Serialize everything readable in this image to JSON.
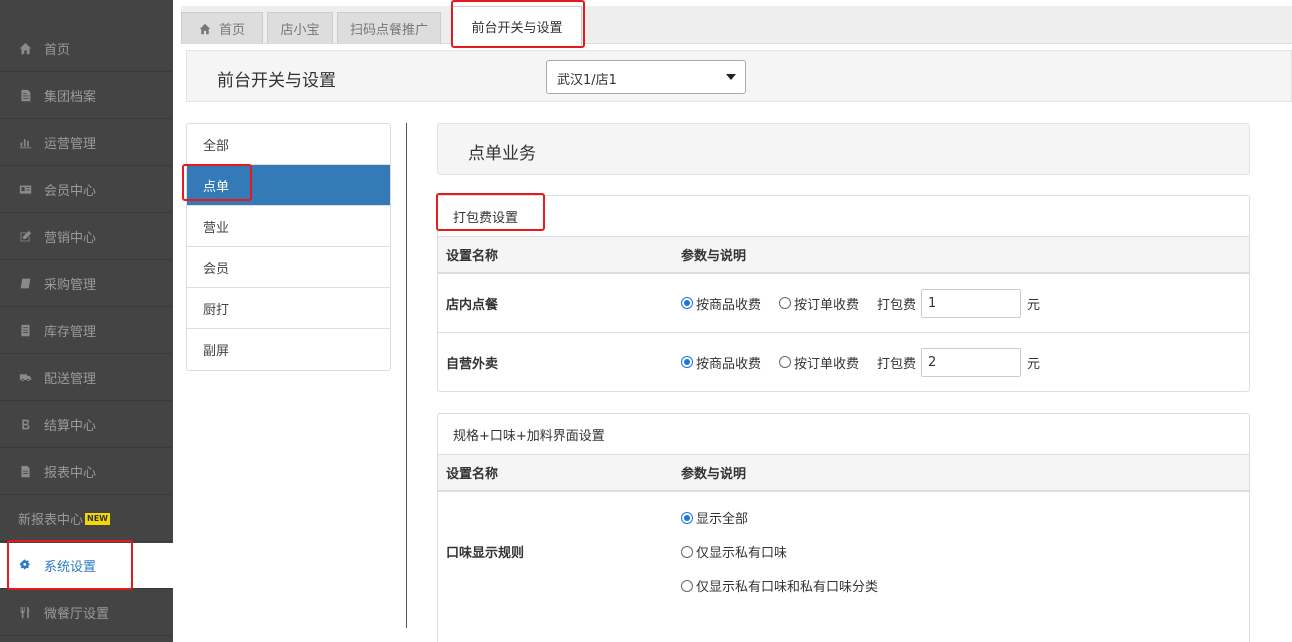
{
  "sidebar": {
    "items": [
      {
        "label": "首页",
        "icon": "home-icon"
      },
      {
        "label": "集团档案",
        "icon": "file-icon"
      },
      {
        "label": "运营管理",
        "icon": "bar-chart-icon"
      },
      {
        "label": "会员中心",
        "icon": "id-card-icon"
      },
      {
        "label": "营销中心",
        "icon": "edit-icon"
      },
      {
        "label": "采购管理",
        "icon": "book-icon"
      },
      {
        "label": "库存管理",
        "icon": "box-icon"
      },
      {
        "label": "配送管理",
        "icon": "truck-icon"
      },
      {
        "label": "结算中心",
        "icon": "bitcoin-icon"
      },
      {
        "label": "报表中心",
        "icon": "document-icon"
      },
      {
        "label": "新报表中心",
        "badge": "NEW"
      },
      {
        "label": "系统设置",
        "icon": "gears-icon"
      },
      {
        "label": "微餐厅设置",
        "icon": "cutlery-icon"
      }
    ]
  },
  "tabs": [
    {
      "label": "首页",
      "icon": "home-icon"
    },
    {
      "label": "店小宝"
    },
    {
      "label": "扫码点餐推广"
    },
    {
      "label": "前台开关与设置"
    }
  ],
  "header": {
    "title": "前台开关与设置",
    "store_select": "武汉1/店1"
  },
  "categories": [
    "全部",
    "点单",
    "营业",
    "会员",
    "厨打",
    "副屏"
  ],
  "section_title": "点单业务",
  "packing": {
    "title": "打包费设置",
    "col_name": "设置名称",
    "col_params": "参数与说明",
    "rows": [
      {
        "name": "店内点餐",
        "opt1": "按商品收费",
        "opt2": "按订单收费",
        "fee_label": "打包费",
        "fee": "1",
        "unit": "元"
      },
      {
        "name": "自营外卖",
        "opt1": "按商品收费",
        "opt2": "按订单收费",
        "fee_label": "打包费",
        "fee": "2",
        "unit": "元"
      }
    ]
  },
  "spec": {
    "title": "规格+口味+加料界面设置",
    "col_name": "设置名称",
    "col_params": "参数与说明",
    "row_name": "口味显示规则",
    "options": [
      "显示全部",
      "仅显示私有口味",
      "仅显示私有口味和私有口味分类"
    ]
  },
  "colors": {
    "sidebar_bg": "#444444",
    "accent": "#337ab7",
    "highlight": "#e8191d"
  }
}
